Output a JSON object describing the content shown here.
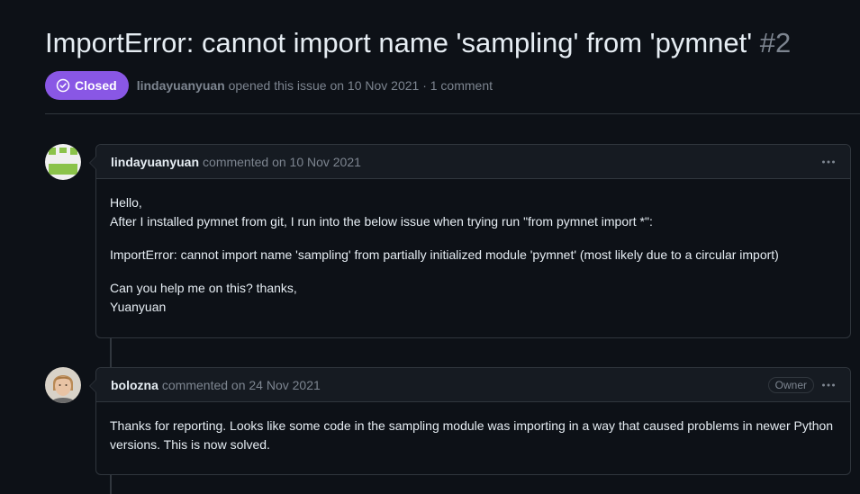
{
  "issue": {
    "title": "ImportError: cannot import name 'sampling' from 'pymnet'",
    "number": "#2",
    "status": "Closed",
    "status_color": "#8957e5",
    "author": "lindayuanyuan",
    "opened_text": "opened this issue on 10 Nov 2021 · 1 comment"
  },
  "comments": [
    {
      "author": "lindayuanyuan",
      "meta": "commented on 10 Nov 2021",
      "menu_icon": "kebab-horizontal-icon",
      "body": {
        "line1": "Hello,",
        "line2": "After I installed pymnet from git, I run into the below issue when trying run \"from pymnet import *\":",
        "error": "ImportError: cannot import name 'sampling' from partially initialized module 'pymnet' (most likely due to a circular import)",
        "line3": "Can you help me on this? thanks,",
        "line4": "Yuanyuan"
      }
    },
    {
      "author": "bolozna",
      "meta": "commented on 24 Nov 2021",
      "role": "Owner",
      "menu_icon": "kebab-horizontal-icon",
      "body": {
        "text": "Thanks for reporting. Looks like some code in the sampling module was importing in a way that caused problems in newer Python versions. This is now solved."
      }
    }
  ]
}
